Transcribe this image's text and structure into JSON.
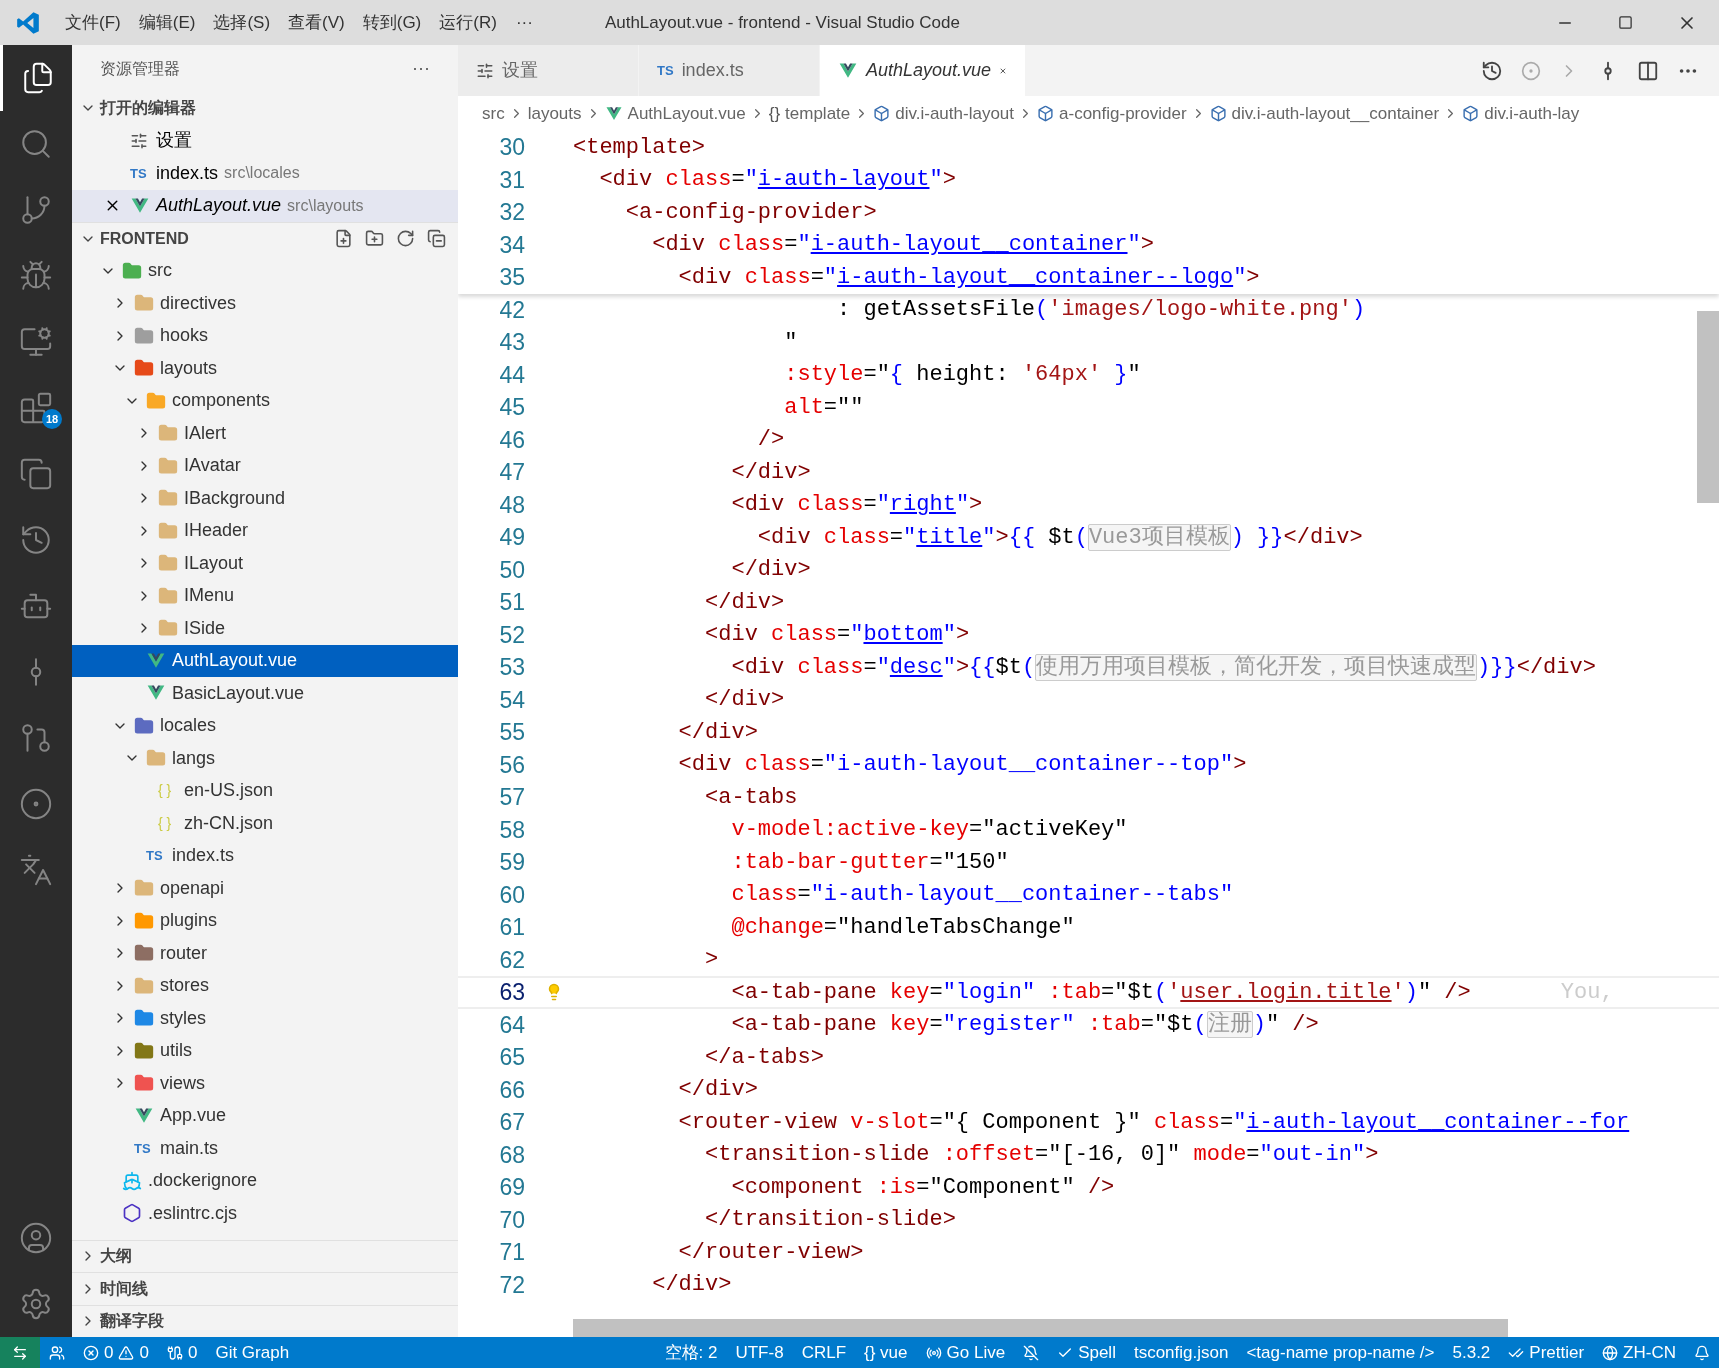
{
  "title_bar": {
    "menus": [
      "文件(F)",
      "编辑(E)",
      "选择(S)",
      "查看(V)",
      "转到(G)",
      "运行(R)"
    ],
    "more": "···",
    "title": "AuthLayout.vue - frontend - Visual Studio Code"
  },
  "activity_bar": {
    "items": [
      {
        "kind": "explorer",
        "selected": true
      },
      {
        "kind": "search",
        "selected": false
      },
      {
        "kind": "source-control",
        "selected": false
      },
      {
        "kind": "run-debug",
        "selected": false
      },
      {
        "kind": "remote",
        "selected": false
      },
      {
        "kind": "extensions",
        "selected": false,
        "badge": "18"
      },
      {
        "kind": "containers",
        "selected": false
      },
      {
        "kind": "timeline",
        "selected": false
      },
      {
        "kind": "bot",
        "selected": false
      },
      {
        "kind": "git-graph",
        "selected": false
      },
      {
        "kind": "git-history",
        "selected": false
      },
      {
        "kind": "gitlens",
        "selected": false
      },
      {
        "kind": "translate",
        "selected": false
      }
    ],
    "bottom": [
      {
        "kind": "account"
      },
      {
        "kind": "settings"
      }
    ]
  },
  "sidebar": {
    "title": "资源管理器",
    "more": "···",
    "open_editors": {
      "title": "打开的编辑器",
      "expanded": true,
      "items": [
        {
          "label": "设置",
          "kind": "settings",
          "selected": false
        },
        {
          "label": "index.ts",
          "path": "src\\locales",
          "kind": "ts",
          "icon_text": "TS",
          "selected": false
        },
        {
          "label": "AuthLayout.vue",
          "path": "src\\layouts",
          "kind": "vue",
          "selected": true
        }
      ]
    },
    "folder": {
      "title": "FRONTEND",
      "expanded": true,
      "items": [
        {
          "label": "src",
          "kind": "folder",
          "color": "#4caf50",
          "expanded": true,
          "selected": false,
          "children": [
            {
              "label": "directives",
              "kind": "folder",
              "color": "#dcb67a",
              "expanded": false,
              "selected": false
            },
            {
              "label": "hooks",
              "kind": "folder",
              "color": "#9e9e9e",
              "expanded": false,
              "selected": false
            },
            {
              "label": "layouts",
              "kind": "folder",
              "color": "#e64a19",
              "expanded": true,
              "selected": false,
              "children": [
                {
                  "label": "components",
                  "kind": "folder",
                  "color": "#f9a825",
                  "expanded": true,
                  "selected": false,
                  "children": [
                    {
                      "label": "IAlert",
                      "kind": "folder",
                      "color": "#dcb67a",
                      "expanded": false,
                      "selected": false
                    },
                    {
                      "label": "IAvatar",
                      "kind": "folder",
                      "color": "#dcb67a",
                      "expanded": false,
                      "selected": false
                    },
                    {
                      "label": "IBackground",
                      "kind": "folder",
                      "color": "#dcb67a",
                      "expanded": false,
                      "selected": false
                    },
                    {
                      "label": "IHeader",
                      "kind": "folder",
                      "color": "#dcb67a",
                      "expanded": false,
                      "selected": false
                    },
                    {
                      "label": "ILayout",
                      "kind": "folder",
                      "color": "#dcb67a",
                      "expanded": false,
                      "selected": false
                    },
                    {
                      "label": "IMenu",
                      "kind": "folder",
                      "color": "#dcb67a",
                      "expanded": false,
                      "selected": false
                    },
                    {
                      "label": "ISide",
                      "kind": "folder",
                      "color": "#dcb67a",
                      "expanded": false,
                      "selected": false
                    }
                  ]
                },
                {
                  "label": "AuthLayout.vue",
                  "kind": "vue",
                  "selected": true
                },
                {
                  "label": "BasicLayout.vue",
                  "kind": "vue",
                  "selected": false
                }
              ]
            },
            {
              "label": "locales",
              "kind": "folder",
              "color": "#5c6bc0",
              "expanded": true,
              "selected": false,
              "children": [
                {
                  "label": "langs",
                  "kind": "folder",
                  "color": "#dcb67a",
                  "expanded": true,
                  "selected": false,
                  "children": [
                    {
                      "label": "en-US.json",
                      "kind": "json",
                      "icon_text": "{ }",
                      "selected": false
                    },
                    {
                      "label": "zh-CN.json",
                      "kind": "json",
                      "icon_text": "{ }",
                      "selected": false
                    }
                  ]
                },
                {
                  "label": "index.ts",
                  "kind": "ts",
                  "icon_text": "TS",
                  "selected": false
                }
              ]
            },
            {
              "label": "openapi",
              "kind": "folder",
              "color": "#dcb67a",
              "expanded": false,
              "selected": false
            },
            {
              "label": "plugins",
              "kind": "folder",
              "color": "#ff9800",
              "expanded": false,
              "selected": false
            },
            {
              "label": "router",
              "kind": "folder",
              "color": "#8d6e63",
              "expanded": false,
              "selected": false
            },
            {
              "label": "stores",
              "kind": "folder",
              "color": "#dcb67a",
              "expanded": false,
              "selected": false
            },
            {
              "label": "styles",
              "kind": "folder",
              "color": "#1e88e5",
              "expanded": false,
              "selected": false
            },
            {
              "label": "utils",
              "kind": "folder",
              "color": "#827717",
              "expanded": false,
              "selected": false
            },
            {
              "label": "views",
              "kind": "folder",
              "color": "#ef5350",
              "expanded": false,
              "selected": false
            },
            {
              "label": "App.vue",
              "kind": "vue",
              "selected": false
            },
            {
              "label": "main.ts",
              "kind": "ts",
              "icon_text": "TS",
              "selected": false
            }
          ]
        },
        {
          "label": ".dockerignore",
          "kind": "docker",
          "selected": false
        },
        {
          "label": ".eslintrc.cjs",
          "kind": "eslint",
          "selected": false
        }
      ]
    },
    "panels": [
      {
        "title": "大纲",
        "expanded": false
      },
      {
        "title": "时间线",
        "expanded": false
      },
      {
        "title": "翻译字段",
        "expanded": false
      }
    ]
  },
  "tabs": [
    {
      "label": "设置",
      "kind": "settings",
      "selected": false
    },
    {
      "label": "index.ts",
      "kind": "ts",
      "icon_text": "TS",
      "selected": false
    },
    {
      "label": "AuthLayout.vue",
      "kind": "vue",
      "selected": true
    }
  ],
  "breadcrumb": [
    {
      "label": "src",
      "kind": "folder"
    },
    {
      "label": "layouts",
      "kind": "folder"
    },
    {
      "label": "AuthLayout.vue",
      "kind": "vue"
    },
    {
      "label": "template",
      "kind": "braces",
      "icon_text": "{}"
    },
    {
      "label": "div.i-auth-layout",
      "kind": "element"
    },
    {
      "label": "a-config-provider",
      "kind": "element"
    },
    {
      "label": "div.i-auth-layout__container",
      "kind": "element"
    },
    {
      "label": "div.i-auth-lay",
      "kind": "element"
    }
  ],
  "editor": {
    "sticky_lines": [
      {
        "number": "30",
        "tokens": [
          {
            "kind": "tag",
            "text": "<template>"
          }
        ]
      },
      {
        "number": "31",
        "tokens": [
          {
            "kind": "tag",
            "text": "  <div"
          },
          {
            "kind": "attr",
            "text": " class"
          },
          {
            "kind": "plain",
            "text": "="
          },
          {
            "kind": "val",
            "text": "\""
          },
          {
            "kind": "link",
            "text": "i-auth-layout"
          },
          {
            "kind": "val",
            "text": "\""
          },
          {
            "kind": "tag",
            "text": ">"
          }
        ]
      },
      {
        "number": "32",
        "tokens": [
          {
            "kind": "tag",
            "text": "    <a-config-provider>"
          }
        ]
      },
      {
        "number": "34",
        "tokens": [
          {
            "kind": "tag",
            "text": "      <div"
          },
          {
            "kind": "attr",
            "text": " class"
          },
          {
            "kind": "plain",
            "text": "="
          },
          {
            "kind": "val",
            "text": "\""
          },
          {
            "kind": "link",
            "text": "i-auth-layout__container"
          },
          {
            "kind": "val",
            "text": "\""
          },
          {
            "kind": "tag",
            "text": ">"
          }
        ]
      },
      {
        "number": "35",
        "tokens": [
          {
            "kind": "tag",
            "text": "        <div"
          },
          {
            "kind": "attr",
            "text": " class"
          },
          {
            "kind": "plain",
            "text": "="
          },
          {
            "kind": "val",
            "text": "\""
          },
          {
            "kind": "link",
            "text": "i-auth-layout__container--logo"
          },
          {
            "kind": "val",
            "text": "\""
          },
          {
            "kind": "tag",
            "text": ">"
          }
        ]
      }
    ],
    "lines": [
      {
        "number": "42",
        "current": false,
        "lightbulb": false,
        "tokens": [
          {
            "kind": "plain",
            "text": "                    : getAssetsFile"
          },
          {
            "kind": "brace",
            "text": "("
          },
          {
            "kind": "str",
            "text": "'images/logo-white.png'"
          },
          {
            "kind": "brace",
            "text": ")"
          }
        ]
      },
      {
        "number": "43",
        "current": false,
        "lightbulb": false,
        "tokens": [
          {
            "kind": "plain",
            "text": "                \""
          }
        ]
      },
      {
        "number": "44",
        "current": false,
        "lightbulb": false,
        "tokens": [
          {
            "kind": "attr",
            "text": "                :style"
          },
          {
            "kind": "plain",
            "text": "=\""
          },
          {
            "kind": "brace",
            "text": "{"
          },
          {
            "kind": "plain",
            "text": " height: "
          },
          {
            "kind": "str",
            "text": "'64px'"
          },
          {
            "kind": "brace",
            "text": " }"
          },
          {
            "kind": "plain",
            "text": "\""
          }
        ]
      },
      {
        "number": "45",
        "current": false,
        "lightbulb": false,
        "tokens": [
          {
            "kind": "attr",
            "text": "                alt"
          },
          {
            "kind": "plain",
            "text": "=\"\""
          }
        ]
      },
      {
        "number": "46",
        "current": false,
        "lightbulb": false,
        "tokens": [
          {
            "kind": "tag",
            "text": "              />"
          }
        ]
      },
      {
        "number": "47",
        "current": false,
        "lightbulb": false,
        "tokens": [
          {
            "kind": "tag",
            "text": "            </div>"
          }
        ]
      },
      {
        "number": "48",
        "current": false,
        "lightbulb": false,
        "tokens": [
          {
            "kind": "tag",
            "text": "            <div"
          },
          {
            "kind": "attr",
            "text": " class"
          },
          {
            "kind": "plain",
            "text": "="
          },
          {
            "kind": "val",
            "text": "\""
          },
          {
            "kind": "link",
            "text": "right"
          },
          {
            "kind": "val",
            "text": "\""
          },
          {
            "kind": "tag",
            "text": ">"
          }
        ]
      },
      {
        "number": "49",
        "current": false,
        "lightbulb": false,
        "tokens": [
          {
            "kind": "tag",
            "text": "              <div"
          },
          {
            "kind": "attr",
            "text": " class"
          },
          {
            "kind": "plain",
            "text": "="
          },
          {
            "kind": "val",
            "text": "\""
          },
          {
            "kind": "link",
            "text": "title"
          },
          {
            "kind": "val",
            "text": "\""
          },
          {
            "kind": "tag",
            "text": ">"
          },
          {
            "kind": "brace",
            "text": "{{"
          },
          {
            "kind": "plain",
            "text": " $t"
          },
          {
            "kind": "brace",
            "text": "("
          },
          {
            "kind": "hint",
            "text": "Vue3项目模板"
          },
          {
            "kind": "brace",
            "text": ")"
          },
          {
            "kind": "brace",
            "text": " }}"
          },
          {
            "kind": "tag",
            "text": "</div>"
          }
        ]
      },
      {
        "number": "50",
        "current": false,
        "lightbulb": false,
        "tokens": [
          {
            "kind": "tag",
            "text": "            </div>"
          }
        ]
      },
      {
        "number": "51",
        "current": false,
        "lightbulb": false,
        "tokens": [
          {
            "kind": "tag",
            "text": "          </div>"
          }
        ]
      },
      {
        "number": "52",
        "current": false,
        "lightbulb": false,
        "tokens": [
          {
            "kind": "tag",
            "text": "          <div"
          },
          {
            "kind": "attr",
            "text": " class"
          },
          {
            "kind": "plain",
            "text": "="
          },
          {
            "kind": "val",
            "text": "\""
          },
          {
            "kind": "link",
            "text": "bottom"
          },
          {
            "kind": "val",
            "text": "\""
          },
          {
            "kind": "tag",
            "text": ">"
          }
        ]
      },
      {
        "number": "53",
        "current": false,
        "lightbulb": false,
        "tokens": [
          {
            "kind": "tag",
            "text": "            <div"
          },
          {
            "kind": "attr",
            "text": " class"
          },
          {
            "kind": "plain",
            "text": "="
          },
          {
            "kind": "val",
            "text": "\""
          },
          {
            "kind": "link",
            "text": "desc"
          },
          {
            "kind": "val",
            "text": "\""
          },
          {
            "kind": "tag",
            "text": ">"
          },
          {
            "kind": "brace",
            "text": "{{"
          },
          {
            "kind": "plain",
            "text": "$t"
          },
          {
            "kind": "brace",
            "text": "("
          },
          {
            "kind": "hint",
            "text": "使用万用项目模板，简化开发，项目快速成型"
          },
          {
            "kind": "brace",
            "text": ")"
          },
          {
            "kind": "brace",
            "text": "}}"
          },
          {
            "kind": "tag",
            "text": "</div>"
          }
        ]
      },
      {
        "number": "54",
        "current": false,
        "lightbulb": false,
        "tokens": [
          {
            "kind": "tag",
            "text": "          </div>"
          }
        ]
      },
      {
        "number": "55",
        "current": false,
        "lightbulb": false,
        "tokens": [
          {
            "kind": "tag",
            "text": "        </div>"
          }
        ]
      },
      {
        "number": "56",
        "current": false,
        "lightbulb": false,
        "tokens": [
          {
            "kind": "tag",
            "text": "        <div"
          },
          {
            "kind": "attr",
            "text": " class"
          },
          {
            "kind": "plain",
            "text": "="
          },
          {
            "kind": "val",
            "text": "\"i-auth-layout__container--top\""
          },
          {
            "kind": "tag",
            "text": ">"
          }
        ]
      },
      {
        "number": "57",
        "current": false,
        "lightbulb": false,
        "tokens": [
          {
            "kind": "tag",
            "text": "          <a-tabs"
          }
        ]
      },
      {
        "number": "58",
        "current": false,
        "lightbulb": false,
        "tokens": [
          {
            "kind": "attr",
            "text": "            v-model:active-key"
          },
          {
            "kind": "plain",
            "text": "=\"activeKey\""
          }
        ]
      },
      {
        "number": "59",
        "current": false,
        "lightbulb": false,
        "tokens": [
          {
            "kind": "attr",
            "text": "            :tab-bar-gutter"
          },
          {
            "kind": "plain",
            "text": "=\"150\""
          }
        ]
      },
      {
        "number": "60",
        "current": false,
        "lightbulb": false,
        "tokens": [
          {
            "kind": "attr",
            "text": "            class"
          },
          {
            "kind": "plain",
            "text": "="
          },
          {
            "kind": "val",
            "text": "\"i-auth-layout__container--tabs\""
          }
        ]
      },
      {
        "number": "61",
        "current": false,
        "lightbulb": false,
        "tokens": [
          {
            "kind": "attr",
            "text": "            @change"
          },
          {
            "kind": "plain",
            "text": "=\"handleTabsChange\""
          }
        ]
      },
      {
        "number": "62",
        "current": false,
        "lightbulb": false,
        "tokens": [
          {
            "kind": "tag",
            "text": "          >"
          }
        ]
      },
      {
        "number": "63",
        "current": true,
        "lightbulb": true,
        "blame": "You,",
        "tokens": [
          {
            "kind": "tag",
            "text": "            <a-tab-pane"
          },
          {
            "kind": "attr",
            "text": " key"
          },
          {
            "kind": "plain",
            "text": "="
          },
          {
            "kind": "val",
            "text": "\"login\""
          },
          {
            "kind": "attr",
            "text": " :tab"
          },
          {
            "kind": "plain",
            "text": "=\"$t"
          },
          {
            "kind": "brace",
            "text": "("
          },
          {
            "kind": "str",
            "text": "'"
          },
          {
            "kind": "strlink",
            "text": "user.login.title"
          },
          {
            "kind": "str",
            "text": "'"
          },
          {
            "kind": "brace",
            "text": ")"
          },
          {
            "kind": "plain",
            "text": "\""
          },
          {
            "kind": "tag",
            "text": " />"
          }
        ]
      },
      {
        "number": "64",
        "current": false,
        "lightbulb": false,
        "tokens": [
          {
            "kind": "tag",
            "text": "            <a-tab-pane"
          },
          {
            "kind": "attr",
            "text": " key"
          },
          {
            "kind": "plain",
            "text": "="
          },
          {
            "kind": "val",
            "text": "\"register\""
          },
          {
            "kind": "attr",
            "text": " :tab"
          },
          {
            "kind": "plain",
            "text": "=\"$t"
          },
          {
            "kind": "brace",
            "text": "("
          },
          {
            "kind": "hint",
            "text": "注册"
          },
          {
            "kind": "brace",
            "text": ")"
          },
          {
            "kind": "plain",
            "text": "\""
          },
          {
            "kind": "tag",
            "text": " />"
          }
        ]
      },
      {
        "number": "65",
        "current": false,
        "lightbulb": false,
        "tokens": [
          {
            "kind": "tag",
            "text": "          </a-tabs>"
          }
        ]
      },
      {
        "number": "66",
        "current": false,
        "lightbulb": false,
        "tokens": [
          {
            "kind": "tag",
            "text": "        </div>"
          }
        ]
      },
      {
        "number": "67",
        "current": false,
        "lightbulb": false,
        "tokens": [
          {
            "kind": "tag",
            "text": "        <router-view"
          },
          {
            "kind": "attr",
            "text": " v-slot"
          },
          {
            "kind": "plain",
            "text": "=\"{ Component }\""
          },
          {
            "kind": "attr",
            "text": " class"
          },
          {
            "kind": "plain",
            "text": "="
          },
          {
            "kind": "val",
            "text": "\""
          },
          {
            "kind": "link",
            "text": "i-auth-layout__container--for"
          }
        ]
      },
      {
        "number": "68",
        "current": false,
        "lightbulb": false,
        "tokens": [
          {
            "kind": "tag",
            "text": "          <transition-slide"
          },
          {
            "kind": "attr",
            "text": " :offset"
          },
          {
            "kind": "plain",
            "text": "=\"[-16, 0]\""
          },
          {
            "kind": "attr",
            "text": " mode"
          },
          {
            "kind": "plain",
            "text": "="
          },
          {
            "kind": "val",
            "text": "\"out-in\""
          },
          {
            "kind": "tag",
            "text": ">"
          }
        ]
      },
      {
        "number": "69",
        "current": false,
        "lightbulb": false,
        "tokens": [
          {
            "kind": "tag",
            "text": "            <component"
          },
          {
            "kind": "attr",
            "text": " :is"
          },
          {
            "kind": "plain",
            "text": "=\"Component\""
          },
          {
            "kind": "tag",
            "text": " />"
          }
        ]
      },
      {
        "number": "70",
        "current": false,
        "lightbulb": false,
        "tokens": [
          {
            "kind": "tag",
            "text": "          </transition-slide>"
          }
        ]
      },
      {
        "number": "71",
        "current": false,
        "lightbulb": false,
        "tokens": [
          {
            "kind": "tag",
            "text": "        </router-view>"
          }
        ]
      },
      {
        "number": "72",
        "current": false,
        "lightbulb": false,
        "tokens": [
          {
            "kind": "tag",
            "text": "      </div>"
          }
        ]
      }
    ]
  },
  "status_bar": {
    "left": [
      {
        "kind": "remote"
      },
      {
        "kind": "live-share"
      },
      {
        "kind": "problems",
        "errors": "0",
        "warnings": "0"
      },
      {
        "kind": "ports",
        "text": "0"
      },
      {
        "kind": "text",
        "text": "Git Graph"
      }
    ],
    "right": [
      {
        "kind": "text",
        "text": "空格: 2"
      },
      {
        "kind": "text",
        "text": "UTF-8"
      },
      {
        "kind": "text",
        "text": "CRLF"
      },
      {
        "kind": "text",
        "text": "{} vue"
      },
      {
        "kind": "golive",
        "text": "Go Live"
      },
      {
        "kind": "feedback"
      },
      {
        "kind": "check",
        "text": "Spell"
      },
      {
        "kind": "text",
        "text": "tsconfig.json"
      },
      {
        "kind": "text",
        "text": "<tag-name prop-name />"
      },
      {
        "kind": "text",
        "text": "5.3.2"
      },
      {
        "kind": "checks",
        "text": "Prettier"
      },
      {
        "kind": "globe",
        "text": "ZH-CN"
      },
      {
        "kind": "bell"
      }
    ]
  }
}
